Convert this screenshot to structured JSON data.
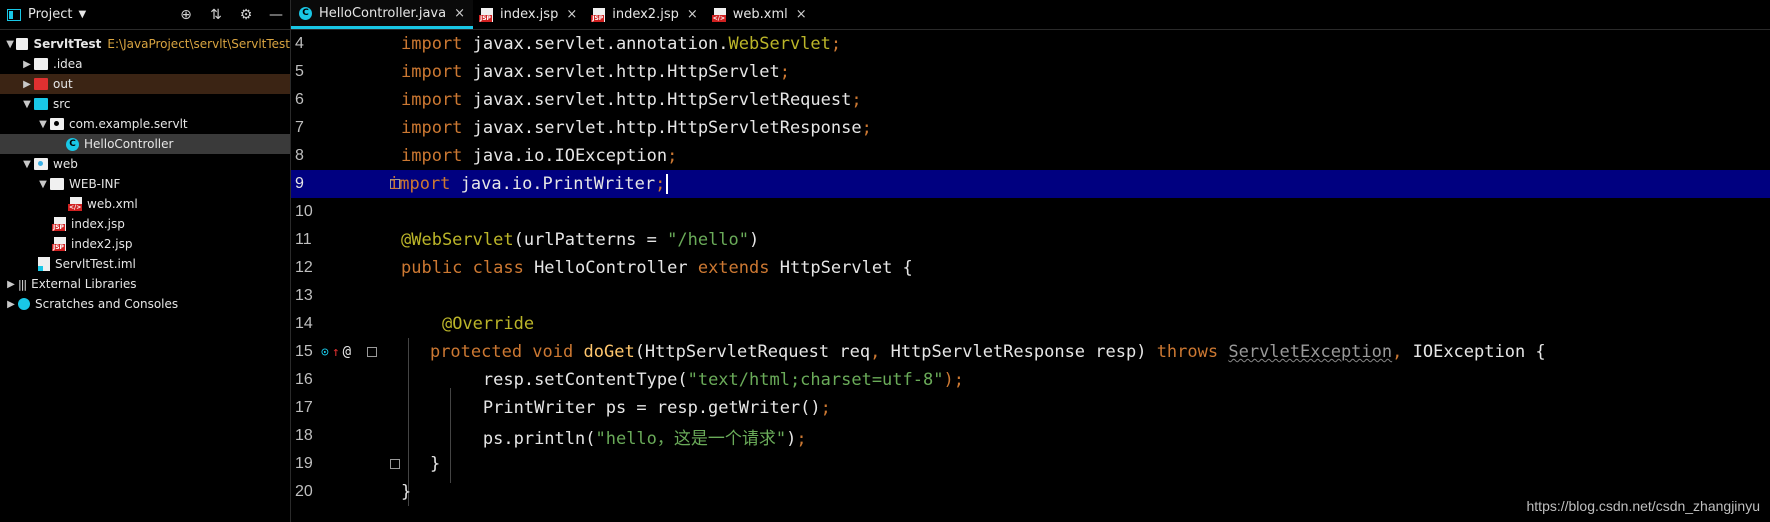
{
  "project": {
    "title": "Project",
    "tree": [
      {
        "label": "ServltTest",
        "path": "E:\\JavaProject\\servlt\\ServltTest"
      },
      {
        "label": ".idea"
      },
      {
        "label": "out"
      },
      {
        "label": "src"
      },
      {
        "label": "com.example.servlt"
      },
      {
        "label": "HelloController"
      },
      {
        "label": "web"
      },
      {
        "label": "WEB-INF"
      },
      {
        "label": "web.xml"
      },
      {
        "label": "index.jsp"
      },
      {
        "label": "index2.jsp"
      },
      {
        "label": "ServltTest.iml"
      },
      {
        "label": "External Libraries"
      },
      {
        "label": "Scratches and Consoles"
      }
    ]
  },
  "tabs": [
    {
      "label": "HelloController.java",
      "active": true
    },
    {
      "label": "index.jsp"
    },
    {
      "label": "index2.jsp"
    },
    {
      "label": "web.xml"
    }
  ],
  "editor": {
    "line_numbers": [
      "4",
      "5",
      "6",
      "7",
      "8",
      "9",
      "10",
      "11",
      "12",
      "13",
      "14",
      "15",
      "16",
      "17",
      "18",
      "19",
      "20"
    ],
    "current_line": "9"
  },
  "code": {
    "l4": [
      "import",
      " javax.servlet.annotation.",
      "WebServlet",
      ";"
    ],
    "l5": [
      "import",
      " javax.servlet.http.HttpServlet",
      ";"
    ],
    "l6": [
      "import",
      " javax.servlet.http.HttpServletRequest",
      ";"
    ],
    "l7": [
      "import",
      " javax.servlet.http.HttpServletResponse",
      ";"
    ],
    "l8": [
      "import",
      " java.io.IOException",
      ";"
    ],
    "l9": [
      "import",
      " java.io.PrintWriter",
      ";"
    ],
    "l11": [
      "@WebServlet",
      "(urlPatterns = ",
      "\"/hello\"",
      ")"
    ],
    "l12": [
      "public class",
      " HelloController ",
      "extends",
      " HttpServlet {"
    ],
    "l14": [
      "@Override"
    ],
    "l15": [
      "protected void",
      " ",
      "doGet",
      "(HttpServletRequest req",
      ",",
      " HttpServletResponse resp) ",
      "throws",
      " ",
      "ServletException",
      ",",
      " IOException {"
    ],
    "l16": [
      "resp.setContentType(",
      "\"text/html;charset=utf-8\"",
      ");"
    ],
    "l17": [
      "PrintWriter ps = resp.getWriter()",
      ";"
    ],
    "l18": [
      "ps.println(",
      "\"hello，这是一个请求\"",
      ")",
      ";"
    ],
    "l19": [
      "}"
    ],
    "l20": [
      "}"
    ]
  },
  "watermark": "https://blog.csdn.net/csdn_zhangjinyu",
  "colors": {
    "keyword": "#cc7832",
    "annotation": "#bbb529",
    "string": "#6a8759",
    "current_line_bg": "#000080",
    "tab_underline": "#19c7e6"
  }
}
